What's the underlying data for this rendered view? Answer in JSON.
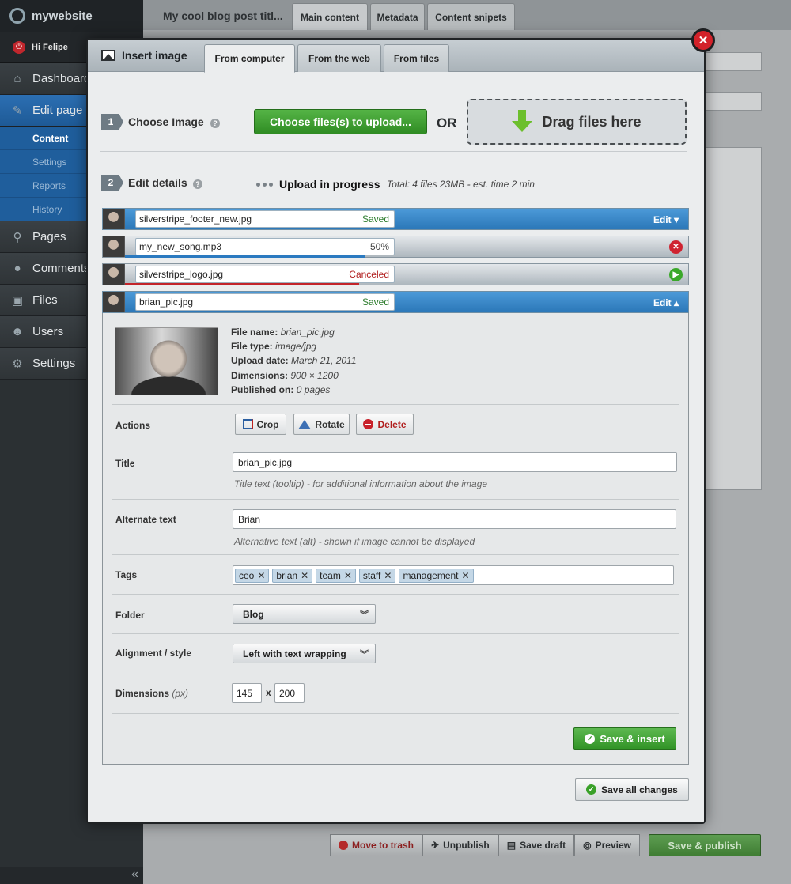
{
  "cms": {
    "brand": "mywebsite",
    "user_greeting": "Hi Felipe",
    "page_title": "My cool blog post titl...",
    "top_tabs": [
      "Main content",
      "Metadata",
      "Content snipets"
    ],
    "nav": [
      {
        "label": "Dashboard",
        "icon": "home-icon"
      },
      {
        "label": "Edit page",
        "icon": "pencil-icon"
      },
      {
        "label": "Pages",
        "icon": "sitemap-icon"
      },
      {
        "label": "Comments",
        "icon": "comment-icon"
      },
      {
        "label": "Files",
        "icon": "image-icon"
      },
      {
        "label": "Users",
        "icon": "users-icon"
      },
      {
        "label": "Settings",
        "icon": "gear-icon"
      }
    ],
    "subnav": [
      "Content",
      "Settings",
      "Reports",
      "History"
    ],
    "collapse": "«",
    "bottom_actions": [
      "Move to trash",
      "Unpublish",
      "Save draft",
      "Preview"
    ],
    "publish": "Save & publish"
  },
  "modal": {
    "title": "Insert image",
    "tabs": [
      "From computer",
      "From the web",
      "From files"
    ],
    "step1": {
      "num": "1",
      "label": "Choose Image"
    },
    "choose_button": "Choose files(s) to upload...",
    "or_label": "OR",
    "drop_label": "Drag files here",
    "step2": {
      "num": "2",
      "label": "Edit details"
    },
    "upload_status": "Upload in progress",
    "upload_meta": "Total: 4 files 23MB - est. time 2 min",
    "files": [
      {
        "name": "silverstripe_footer_new.jpg",
        "status": "Saved",
        "action": "Edit ▾"
      },
      {
        "name": "my_new_song.mp3",
        "status": "50%",
        "progress": 0.5
      },
      {
        "name": "silverstripe_logo.jpg",
        "status": "Canceled"
      },
      {
        "name": "brian_pic.jpg",
        "status": "Saved",
        "action": "Edit ▴"
      }
    ],
    "details": {
      "file_name_label": "File name:",
      "file_name": "brian_pic.jpg",
      "file_type_label": "File type:",
      "file_type": "image/jpg",
      "upload_date_label": "Upload date:",
      "upload_date": "March 21, 2011",
      "dimensions_label": "Dimensions:",
      "dimensions": "900 × 1200",
      "published_label": "Published on:",
      "published": "0 pages",
      "actions_label": "Actions",
      "crop": "Crop",
      "rotate": "Rotate",
      "delete": "Delete",
      "title_label": "Title",
      "title_value": "brian_pic.jpg",
      "title_hint": "Title text (tooltip) - for additional information about the image",
      "alt_label": "Alternate text",
      "alt_value": "Brian",
      "alt_hint": "Alternative text (alt) - shown if image cannot be displayed",
      "tags_label": "Tags",
      "tags": [
        "ceo",
        "brian",
        "team",
        "staff",
        "management"
      ],
      "folder_label": "Folder",
      "folder_value": "Blog",
      "align_label": "Alignment / style",
      "align_value": "Left with text wrapping",
      "dims_label": "Dimensions",
      "dims_unit": "(px)",
      "width": "145",
      "height": "200",
      "save_insert": "Save & insert"
    },
    "save_all": "Save all changes"
  }
}
